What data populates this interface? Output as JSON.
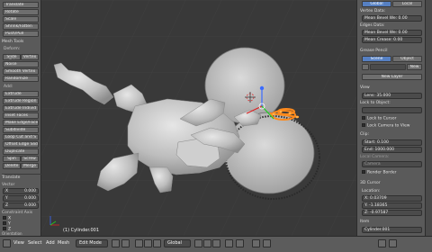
{
  "left_shelf": {
    "tools": [
      "Translate",
      "Rotate",
      "Scale",
      "Shrink/Fatten",
      "Push/Pull"
    ],
    "mesh_tools_header": "Mesh Tools",
    "deform_label": "Deform:",
    "deform_half": [
      "Slide Ed",
      "Vertex"
    ],
    "deform_tools": [
      "Noise",
      "Smooth Vertex",
      "Randomize"
    ],
    "add_label": "Add:",
    "add_tools": [
      "Extrude",
      "Extrude Region",
      "Extrude Individ",
      "Inset Faces",
      "Make Edge/Face",
      "Subdivide",
      "Loop Cut and S",
      "Offset Edge Slide",
      "Duplicate"
    ],
    "spin_row": [
      "Spin",
      "Screw"
    ],
    "delete_row": [
      "Delete",
      "Merge"
    ],
    "translate_header": "Translate",
    "vector_label": "Vector",
    "x_label": "X",
    "x_value": "0.000",
    "y_label": "Y",
    "y_value": "0.000",
    "z_label": "Z",
    "z_value": "0.000",
    "constraint_label": "Constraint Axis",
    "axis_x": "X",
    "axis_y": "Y",
    "axis_z": "Z",
    "orientation_label": "Orientation"
  },
  "viewport": {
    "status": "(1) Cylinder.001"
  },
  "right_panel": {
    "tabs": [
      "Global",
      "Local"
    ],
    "vertex_data_header": "Vertex Data:",
    "mean_bevel_weight_1": "Mean Bevel We: 0.00",
    "edges_data_header": "Edges Data:",
    "mean_bevel_weight_2": "Mean Bevel We: 0.00",
    "mean_crease": "Mean Crease:   0.00",
    "grease_pencil_header": "Grease Pencil",
    "gp_tabs": [
      "Scene",
      "Object"
    ],
    "gp_new": "New",
    "new_layer": "New Layer",
    "view_header": "View",
    "lens": "Lens:           35.000",
    "lock_to_object": "Lock to Object:",
    "lock_to_cursor": "Lock to Cursor",
    "lock_camera": "Lock Camera to View",
    "clip_header": "Clip:",
    "clip_start": "Start:          0.100",
    "clip_end": "End:      1000.000",
    "local_camera": "Local Camera:",
    "camera_field": "Camera",
    "render_border": "Render Border",
    "cursor_header": "3D Cursor",
    "location_label": "Location:",
    "cursor_x": "X:      0.03709",
    "cursor_y": "Y:     -1.18365",
    "cursor_z": "Z:     -0.97587",
    "item_header": "Item",
    "item_name": "Cylinder.001"
  },
  "bottom_bar": {
    "menus": [
      "View",
      "Select",
      "Add",
      "Mesh"
    ],
    "mode": "Edit Mode",
    "pivot": "Global"
  },
  "colors": {
    "viewport_bg": "#393939",
    "panel_bg": "#5a5a5a",
    "selection_orange": "#ff8a1c",
    "active_blue": "#5680c2",
    "mesh_gray": "#c8c8c8"
  },
  "icons": [
    "view-menu-icon",
    "orientation-gizmo-icon",
    "transform-manipulator-icon",
    "snap-magnet-icon"
  ]
}
